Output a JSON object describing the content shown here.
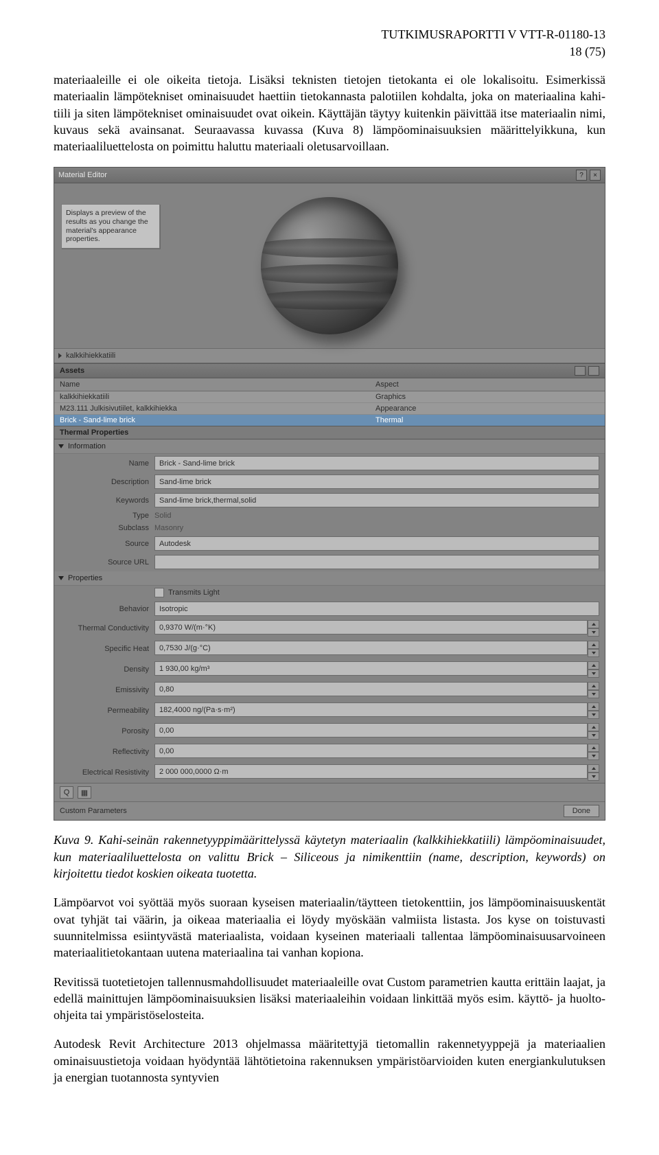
{
  "header": {
    "docref": "TUTKIMUSRAPORTTI V VTT-R-01180-13",
    "pagenum": "18 (75)"
  },
  "intro_para": "materiaaleille ei ole oikeita tietoja. Lisäksi teknisten tietojen tietokanta ei ole lokalisoitu. Esimerkissä materiaalin lämpötekniset ominaisuudet haettiin tietokannasta palotiilen kohdalta, joka on materiaalina kahi-tiili ja siten lämpötekniset ominaisuudet ovat oikein. Käyttäjän täytyy kuitenkin päivittää itse materiaalin nimi, kuvaus sekä avainsanat. Seuraavassa kuvassa (Kuva 8) lämpöominaisuuksien määrittelyikkuna, kun materiaaliluettelosta on poimittu haluttu materiaali oletusarvoillaan.",
  "editor": {
    "title": "Material Editor",
    "help_glyph": "?",
    "close_glyph": "×",
    "hint": "Displays a preview of the results as you change the material's appearance properties.",
    "crumb": "kalkkihiekkatiili",
    "assets_label": "Assets",
    "assets_cols": {
      "name": "Name",
      "aspect": "Aspect"
    },
    "assets_rows": [
      {
        "name": "kalkkihiekkatiili",
        "aspect": "Graphics"
      },
      {
        "name": "M23.111 Julkisivutiilet, kalkkihiekka",
        "aspect": "Appearance"
      },
      {
        "name": "Brick - Sand-lime brick",
        "aspect": "Thermal",
        "selected": true
      }
    ],
    "thermal_label": "Thermal Properties",
    "section_info": "Information",
    "section_props": "Properties",
    "fields": {
      "name_l": "Name",
      "name_v": "Brick - Sand-lime brick",
      "desc_l": "Description",
      "desc_v": "Sand-lime brick",
      "keyw_l": "Keywords",
      "keyw_v": "Sand-lime brick,thermal,solid",
      "type_l": "Type",
      "type_v": "Solid",
      "subc_l": "Subclass",
      "subc_v": "Masonry",
      "src_l": "Source",
      "src_v": "Autodesk",
      "surl_l": "Source URL",
      "surl_v": "",
      "trans_l": "Transmits Light",
      "beh_l": "Behavior",
      "beh_v": "Isotropic",
      "tc_l": "Thermal Conductivity",
      "tc_v": "0,9370 W/(m·°K)",
      "sh_l": "Specific Heat",
      "sh_v": "0,7530 J/(g·°C)",
      "den_l": "Density",
      "den_v": "1 930,00 kg/m³",
      "emi_l": "Emissivity",
      "emi_v": "0,80",
      "perm_l": "Permeability",
      "perm_v": "182,4000 ng/(Pa·s·m²)",
      "por_l": "Porosity",
      "por_v": "0,00",
      "ref_l": "Reflectivity",
      "ref_v": "0,00",
      "er_l": "Electrical Resistivity",
      "er_v": "2 000 000,0000 Ω·m"
    },
    "custom_params": "Custom Parameters",
    "done": "Done"
  },
  "caption": {
    "num": "Kuva 9.",
    "text": " Kahi-seinän rakennetyyppimäärittelyssä käytetyn materiaalin (kalkkihiekkatiili) lämpöominaisuudet, kun materiaaliluettelosta on valittu Brick – Siliceous ja nimikenttiin (name, description, keywords) on kirjoitettu tiedot koskien oikeata tuotetta."
  },
  "para2": "Lämpöarvot voi syöttää myös suoraan kyseisen materiaalin/täytteen tietokenttiin, jos lämpöominaisuuskentät ovat tyhjät tai väärin, ja oikeaa materiaalia ei löydy myöskään valmiista listasta. Jos kyse on toistuvasti suunnitelmissa esiintyvästä materiaalista, voidaan kyseinen materiaali tallentaa lämpöominaisuusarvoineen materiaalitietokantaan uutena materiaalina tai vanhan kopiona.",
  "para3": "Revitissä tuotetietojen tallennusmahdollisuudet materiaaleille ovat Custom parametrien kautta erittäin laajat, ja edellä mainittujen lämpöominaisuuksien lisäksi materiaaleihin voidaan linkittää myös esim. käyttö- ja huolto-ohjeita tai ympäristöselosteita.",
  "para4": "Autodesk Revit Architecture 2013 ohjelmassa määritettyjä tietomallin rakennetyyppejä ja materiaalien ominaisuustietoja voidaan hyödyntää lähtötietoina rakennuksen ympäristöarvioiden kuten energiankulutuksen ja energian tuotannosta syntyvien"
}
